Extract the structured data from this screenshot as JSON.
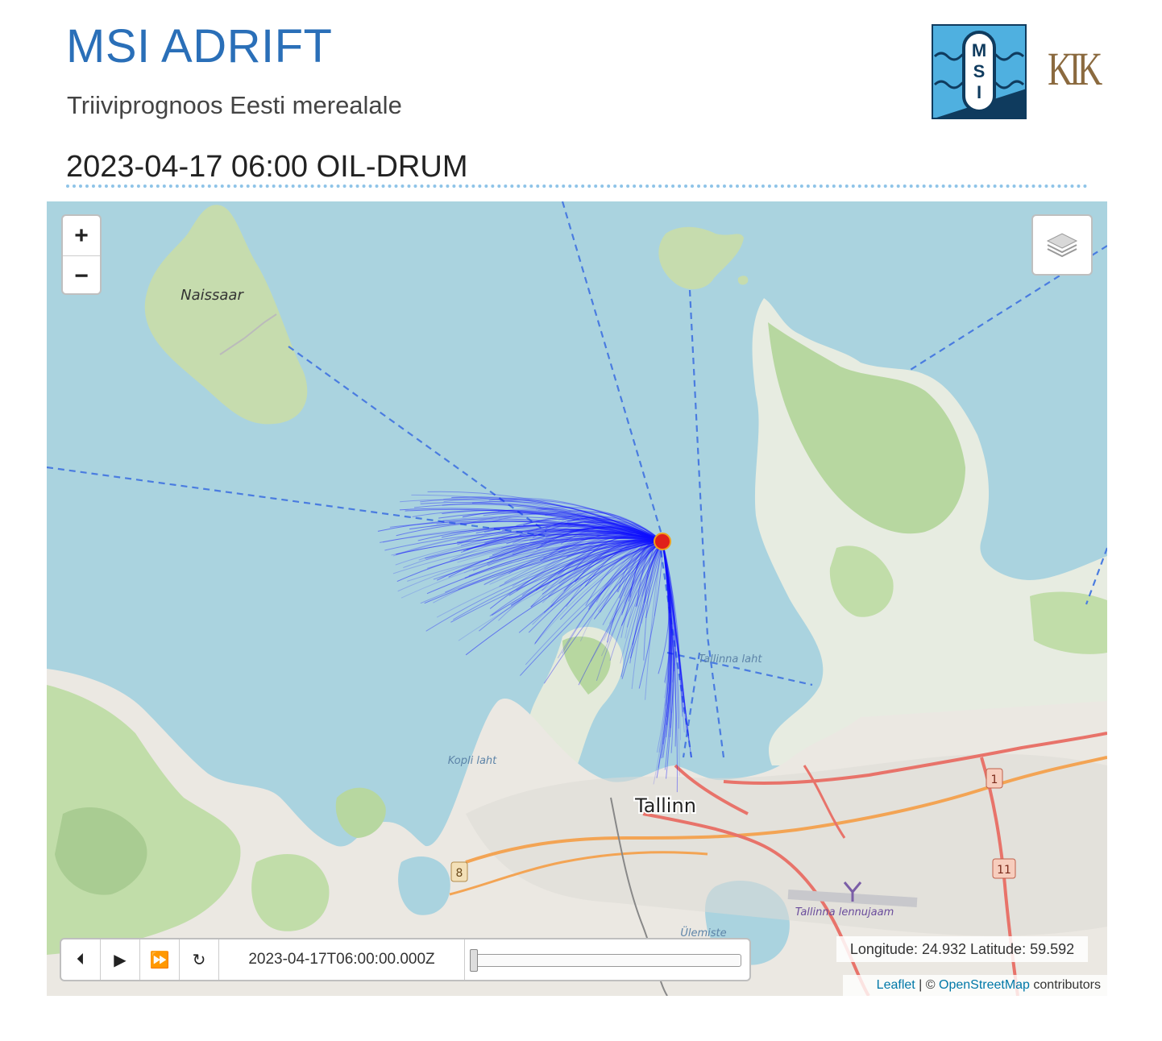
{
  "header": {
    "title": "MSI ADRIFT",
    "subtitle": "Triiviprognoos Eesti merealale",
    "kik_logo_text": "KIK",
    "msi_logo_letters": [
      "M",
      "S",
      "I"
    ]
  },
  "forecast": {
    "heading": "2023-04-17 06:00 OIL-DRUM"
  },
  "map": {
    "zoom_in_label": "+",
    "zoom_out_label": "−",
    "labels": {
      "naissaar": "Naissaar",
      "tallinn": "Tallinn",
      "kopli_laht": "Kopli laht",
      "tallinna_laht": "Tallinna laht",
      "airport": "Tallinna lennujaam",
      "ulemiste": "Ülemiste"
    },
    "road_shields": [
      "8",
      "1",
      "11"
    ],
    "release_point": {
      "longitude": 24.932,
      "latitude": 59.592
    },
    "colors": {
      "sea": "#aad3df",
      "land": "#f2efe9",
      "forest": "#add19e",
      "drift": "#1010ff",
      "marker": "#e0201a",
      "track": "#4a7ce0"
    }
  },
  "timeline": {
    "buttons": [
      "rewind-icon",
      "play-icon",
      "fast-forward-icon",
      "loop-icon"
    ],
    "current_time": "2023-04-17T06:00:00.000Z",
    "position_fraction": 0
  },
  "coords_display": "Longitude: 24.932 Latitude: 59.592",
  "attribution": {
    "leaflet": "Leaflet",
    "separator": " | © ",
    "osm": "OpenStreetMap",
    "suffix": " contributors"
  }
}
